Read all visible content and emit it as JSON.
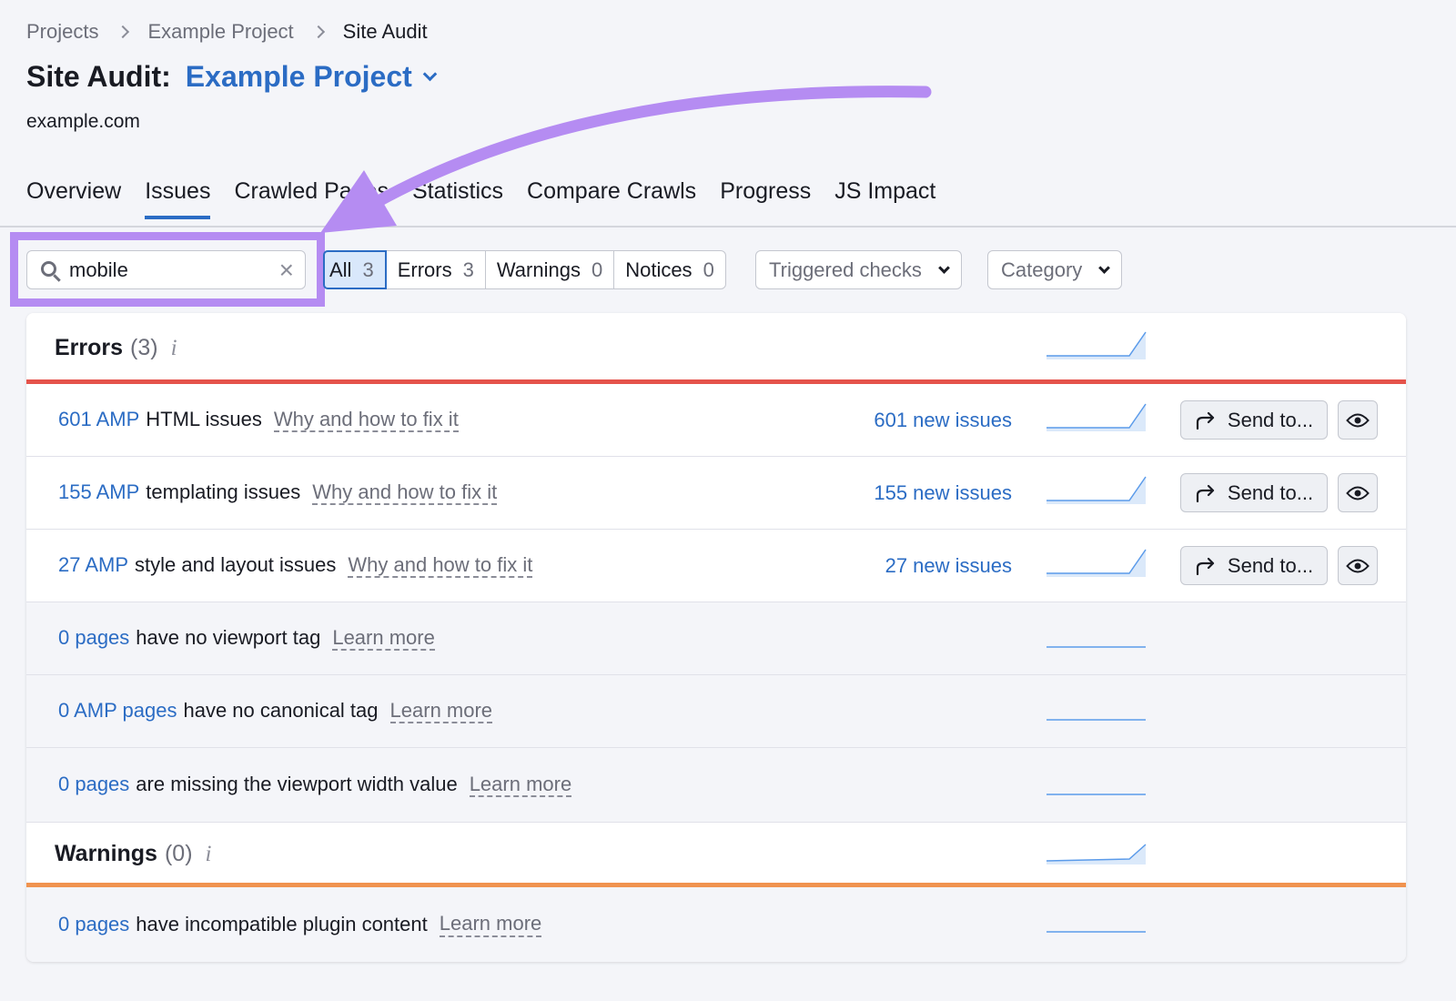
{
  "breadcrumb": [
    "Projects",
    "Example Project",
    "Site Audit"
  ],
  "title": {
    "label": "Site Audit:",
    "project": "Example Project"
  },
  "domain": "example.com",
  "tabs": [
    "Overview",
    "Issues",
    "Crawled Pages",
    "Statistics",
    "Compare Crawls",
    "Progress",
    "JS Impact"
  ],
  "active_tab": "Issues",
  "search": {
    "value": "mobile",
    "clear_icon": "close-icon"
  },
  "filters": [
    {
      "label": "All",
      "count": "3",
      "active": true
    },
    {
      "label": "Errors",
      "count": "3"
    },
    {
      "label": "Warnings",
      "count": "0"
    },
    {
      "label": "Notices",
      "count": "0"
    }
  ],
  "dropdowns": {
    "triggered": "Triggered checks",
    "category": "Category"
  },
  "errors": {
    "title": "Errors",
    "count": "(3)",
    "info": "i",
    "color": "#e5534b",
    "rows": [
      {
        "num": "601 AMP",
        "desc": "HTML issues",
        "fix": "Why and how to fix it",
        "new": "601 new issues",
        "send": "Send to..."
      },
      {
        "num": "155 AMP",
        "desc": "templating issues",
        "fix": "Why and how to fix it",
        "new": "155 new issues",
        "send": "Send to..."
      },
      {
        "num": "27 AMP",
        "desc": "style and layout issues",
        "fix": "Why and how to fix it",
        "new": "27 new issues",
        "send": "Send to..."
      },
      {
        "num": "0 pages",
        "desc": "have no viewport tag",
        "fix": "Learn more"
      },
      {
        "num": "0 AMP pages",
        "desc": "have no canonical tag",
        "fix": "Learn more"
      },
      {
        "num": "0 pages",
        "desc": "are missing the viewport width value",
        "fix": "Learn more"
      }
    ]
  },
  "warnings": {
    "title": "Warnings",
    "count": "(0)",
    "info": "i",
    "color": "#f0934f",
    "rows": [
      {
        "num": "0 pages",
        "desc": "have incompatible plugin content",
        "fix": "Learn more"
      }
    ]
  },
  "accent_color": "#2b6cc4",
  "highlight_color": "#b58cf2"
}
